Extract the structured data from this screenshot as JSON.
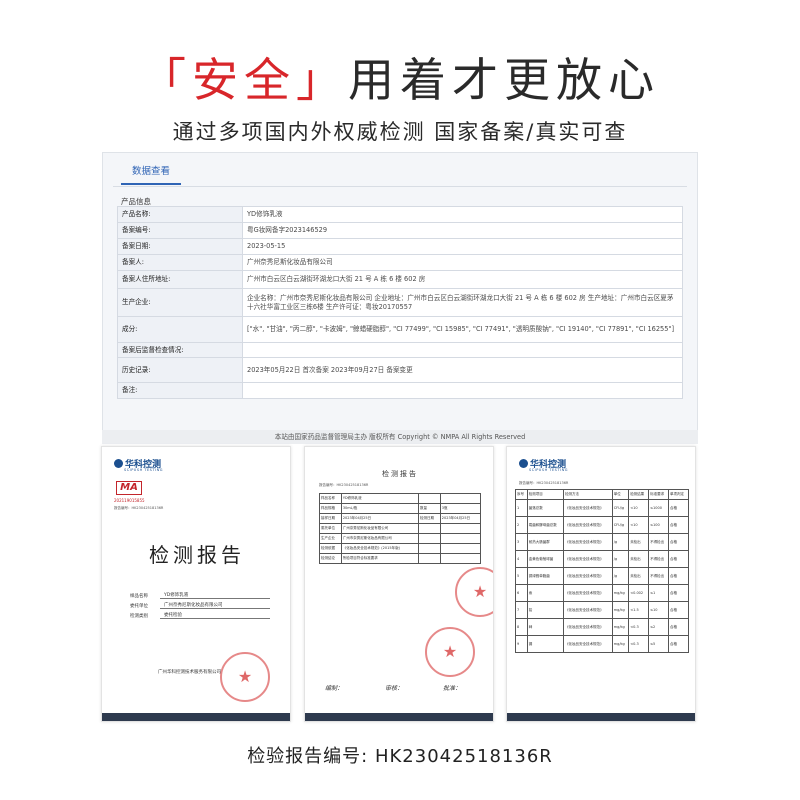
{
  "headline": {
    "bracket_open": "「",
    "highlight": "安全",
    "bracket_close": "」",
    "rest": "用着才更放心"
  },
  "subheadline": "通过多项国内外权威检测  国家备案/真实可查",
  "panel": {
    "tab": "数据查看",
    "section": "产品信息",
    "rows": [
      {
        "key": "产品名称:",
        "value": "YD修饰乳液"
      },
      {
        "key": "备案编号:",
        "value": "粤G妆网备字2023146529"
      },
      {
        "key": "备案日期:",
        "value": "2023-05-15"
      },
      {
        "key": "备案人:",
        "value": "广州奈秀尼斯化妆品有限公司"
      },
      {
        "key": "备案人住所地址:",
        "value": "广州市白云区白云湖街环湖龙口大街 21 号 A 栋 6 楼 602 房"
      },
      {
        "key": "生产企业:",
        "value": "企业名称：广州市奈秀尼斯化妆品有限公司 企业地址：广州市白云区白云湖街环湖龙口大街 21 号 A 栋 6 楼 602 房 生产地址：广州市白云区夏茅十六社华富工业区三栋6楼 生产许可证：粤妆20170557"
      },
      {
        "key": "成分:",
        "value": "[\"水\", \"甘油\", \"丙二醇\", \"卡波姆\", \"鲸蜡硬脂醇\", \"CI 77499\", \"CI 15985\", \"CI 77491\", \"透明质酸钠\", \"CI 19140\", \"CI 77891\", \"CI 16255\"]"
      },
      {
        "key": "备案后监督检查情况:",
        "value": ""
      },
      {
        "key": "历史记录:",
        "value": "2023年05月22日 首次备案 2023年09月27日 备案变更"
      },
      {
        "key": "备注:",
        "value": ""
      }
    ],
    "footer": "本站由国家药品监督管理局主办 版权所有 Copyright © NMPA All Rights Reserved"
  },
  "reports": {
    "logo": "华科控测",
    "logo_sub": "SCIPUSH TESTING",
    "ma": "MA",
    "cma_no": "202119015855",
    "report_id_short": "报告编号：HK23042518136R",
    "cover_title": "检测报告",
    "cover_fields": [
      {
        "k": "样品名称",
        "v": "YD修饰乳液"
      },
      {
        "k": "委托单位",
        "v": "广州奈秀尼斯化妆品有限公司"
      },
      {
        "k": "检测类别",
        "v": "委托检验"
      }
    ],
    "cover_company": "广州华科控测技术服务有限公司",
    "page2_title": "检测报告",
    "page2_rows": [
      [
        "样品名称",
        "YD修饰乳液",
        "",
        ""
      ],
      [
        "样品规格",
        "30mL/瓶",
        "数量",
        "3瓶"
      ],
      [
        "接样日期",
        "2023年04月25日",
        "检测日期",
        "2023年04月25日"
      ],
      [
        "委托单位",
        "广州奈秀尼斯化妆品有限公司",
        "",
        ""
      ],
      [
        "生产企业",
        "广州市奈秀尼斯化妆品有限公司",
        "",
        ""
      ],
      [
        "检测依据",
        "《化妆品安全技术规范》(2015年版)",
        "",
        ""
      ],
      [
        "检测结论",
        "所检项目符合标准要求",
        "",
        ""
      ]
    ],
    "page2_signatures": [
      "编制：",
      "审核：",
      "批准："
    ],
    "page3_header": [
      "序号",
      "检测项目",
      "检测方法",
      "单位",
      "检测结果",
      "标准要求",
      "单项判定"
    ],
    "page3_rows": [
      [
        "1",
        "菌落总数",
        "《化妆品安全技术规范》",
        "CFU/g",
        "<10",
        "≤1000",
        "合格"
      ],
      [
        "2",
        "霉菌和酵母菌总数",
        "《化妆品安全技术规范》",
        "CFU/g",
        "<10",
        "≤100",
        "合格"
      ],
      [
        "3",
        "耐热大肠菌群",
        "《化妆品安全技术规范》",
        "/g",
        "未检出",
        "不得检出",
        "合格"
      ],
      [
        "4",
        "金黄色葡萄球菌",
        "《化妆品安全技术规范》",
        "/g",
        "未检出",
        "不得检出",
        "合格"
      ],
      [
        "5",
        "铜绿假单胞菌",
        "《化妆品安全技术规范》",
        "/g",
        "未检出",
        "不得检出",
        "合格"
      ],
      [
        "6",
        "汞",
        "《化妆品安全技术规范》",
        "mg/kg",
        "<0.002",
        "≤1",
        "合格"
      ],
      [
        "7",
        "铅",
        "《化妆品安全技术规范》",
        "mg/kg",
        "<1.5",
        "≤10",
        "合格"
      ],
      [
        "8",
        "砷",
        "《化妆品安全技术规范》",
        "mg/kg",
        "<0.3",
        "≤2",
        "合格"
      ],
      [
        "9",
        "镉",
        "《化妆品安全技术规范》",
        "mg/kg",
        "<0.3",
        "≤5",
        "合格"
      ]
    ]
  },
  "report_number": "检验报告编号: HK23042518136R"
}
